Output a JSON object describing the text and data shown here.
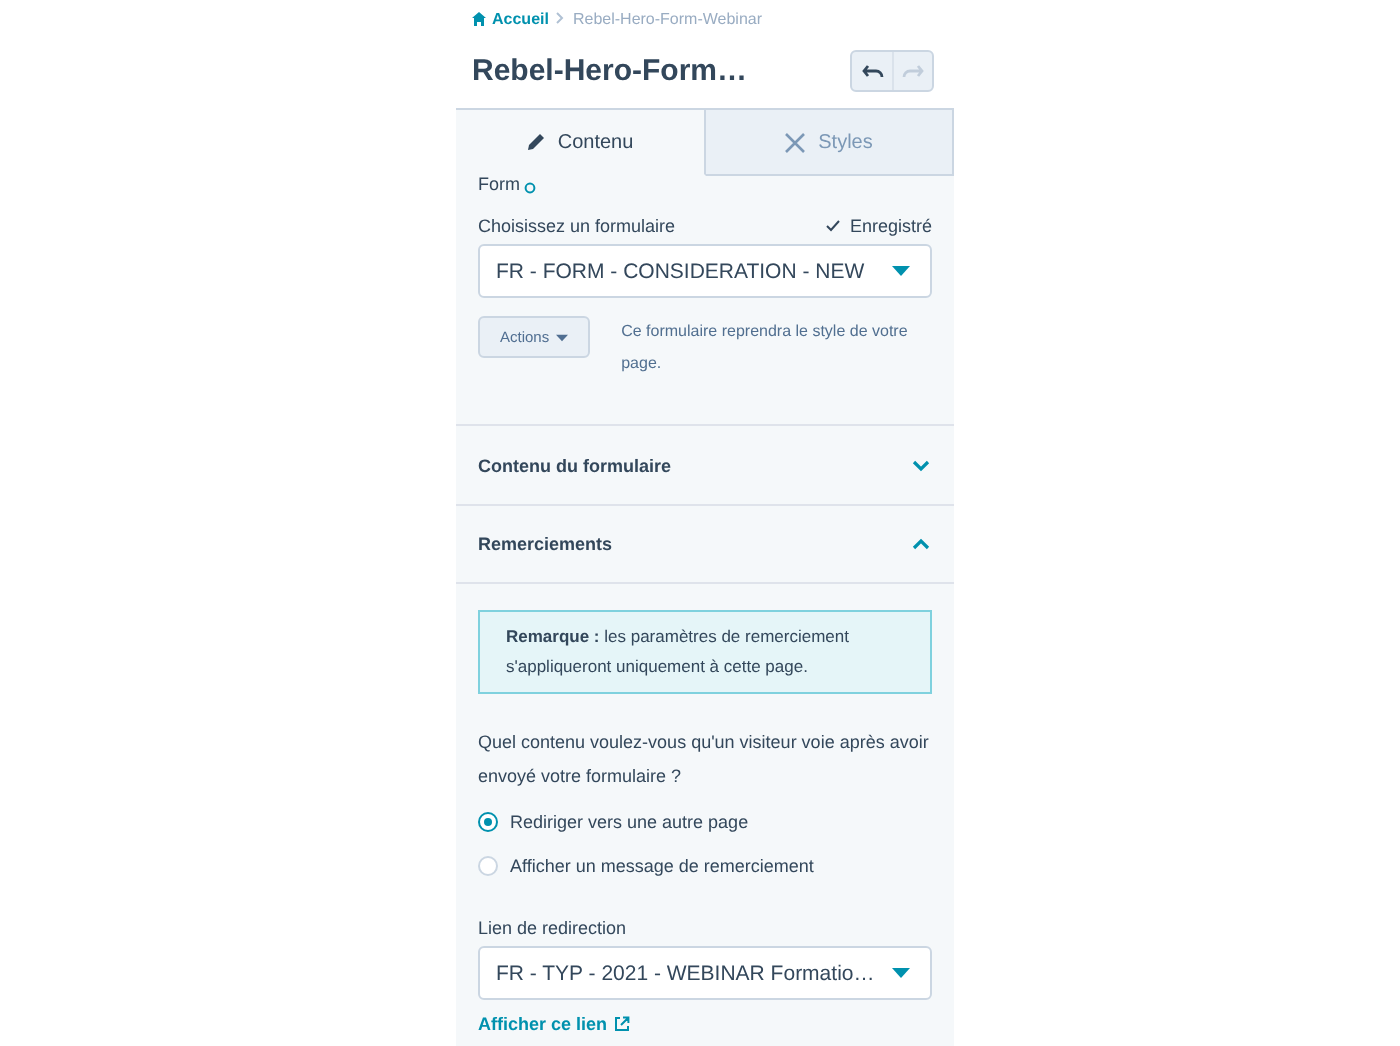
{
  "breadcrumb": {
    "home": "Accueil",
    "current": "Rebel-Hero-Form-Webinar"
  },
  "title": "Rebel-Hero-Form…",
  "history": [
    {
      "kind": "undo",
      "disabled": false
    },
    {
      "kind": "redo",
      "disabled": true
    }
  ],
  "tabs": [
    {
      "kind": "content",
      "label": "Contenu",
      "selected": true
    },
    {
      "kind": "styles",
      "label": "Styles",
      "selected": false
    }
  ],
  "form_picker": {
    "cut_label": "Form",
    "field_label": "Choisissez un formulaire",
    "status": "Enregistré",
    "value": "FR - FORM - CONSIDERATION - NEW",
    "actions_button": "Actions",
    "note": "Ce formulaire reprendra le style de votre page."
  },
  "sections": [
    {
      "title": "Contenu du formulaire",
      "expanded": false
    },
    {
      "title": "Remerciements",
      "expanded": true
    }
  ],
  "thanks": {
    "notice": "**Remarque :** les paramètres de remerciement s'appliqueront uniquement à cette page.",
    "question": "Quel contenu voulez-vous qu'un visiteur voie après avoir envoyé votre formulaire ?",
    "options": [
      {
        "label": "Rediriger vers une autre page",
        "selected": true
      },
      {
        "label": "Afficher un message de remerciement",
        "selected": false
      }
    ],
    "redirect_label": "Lien de redirection",
    "redirect_value": "FR - TYP - 2021 - WEBINAR Formatio…",
    "view_link": "Afficher ce lien"
  }
}
